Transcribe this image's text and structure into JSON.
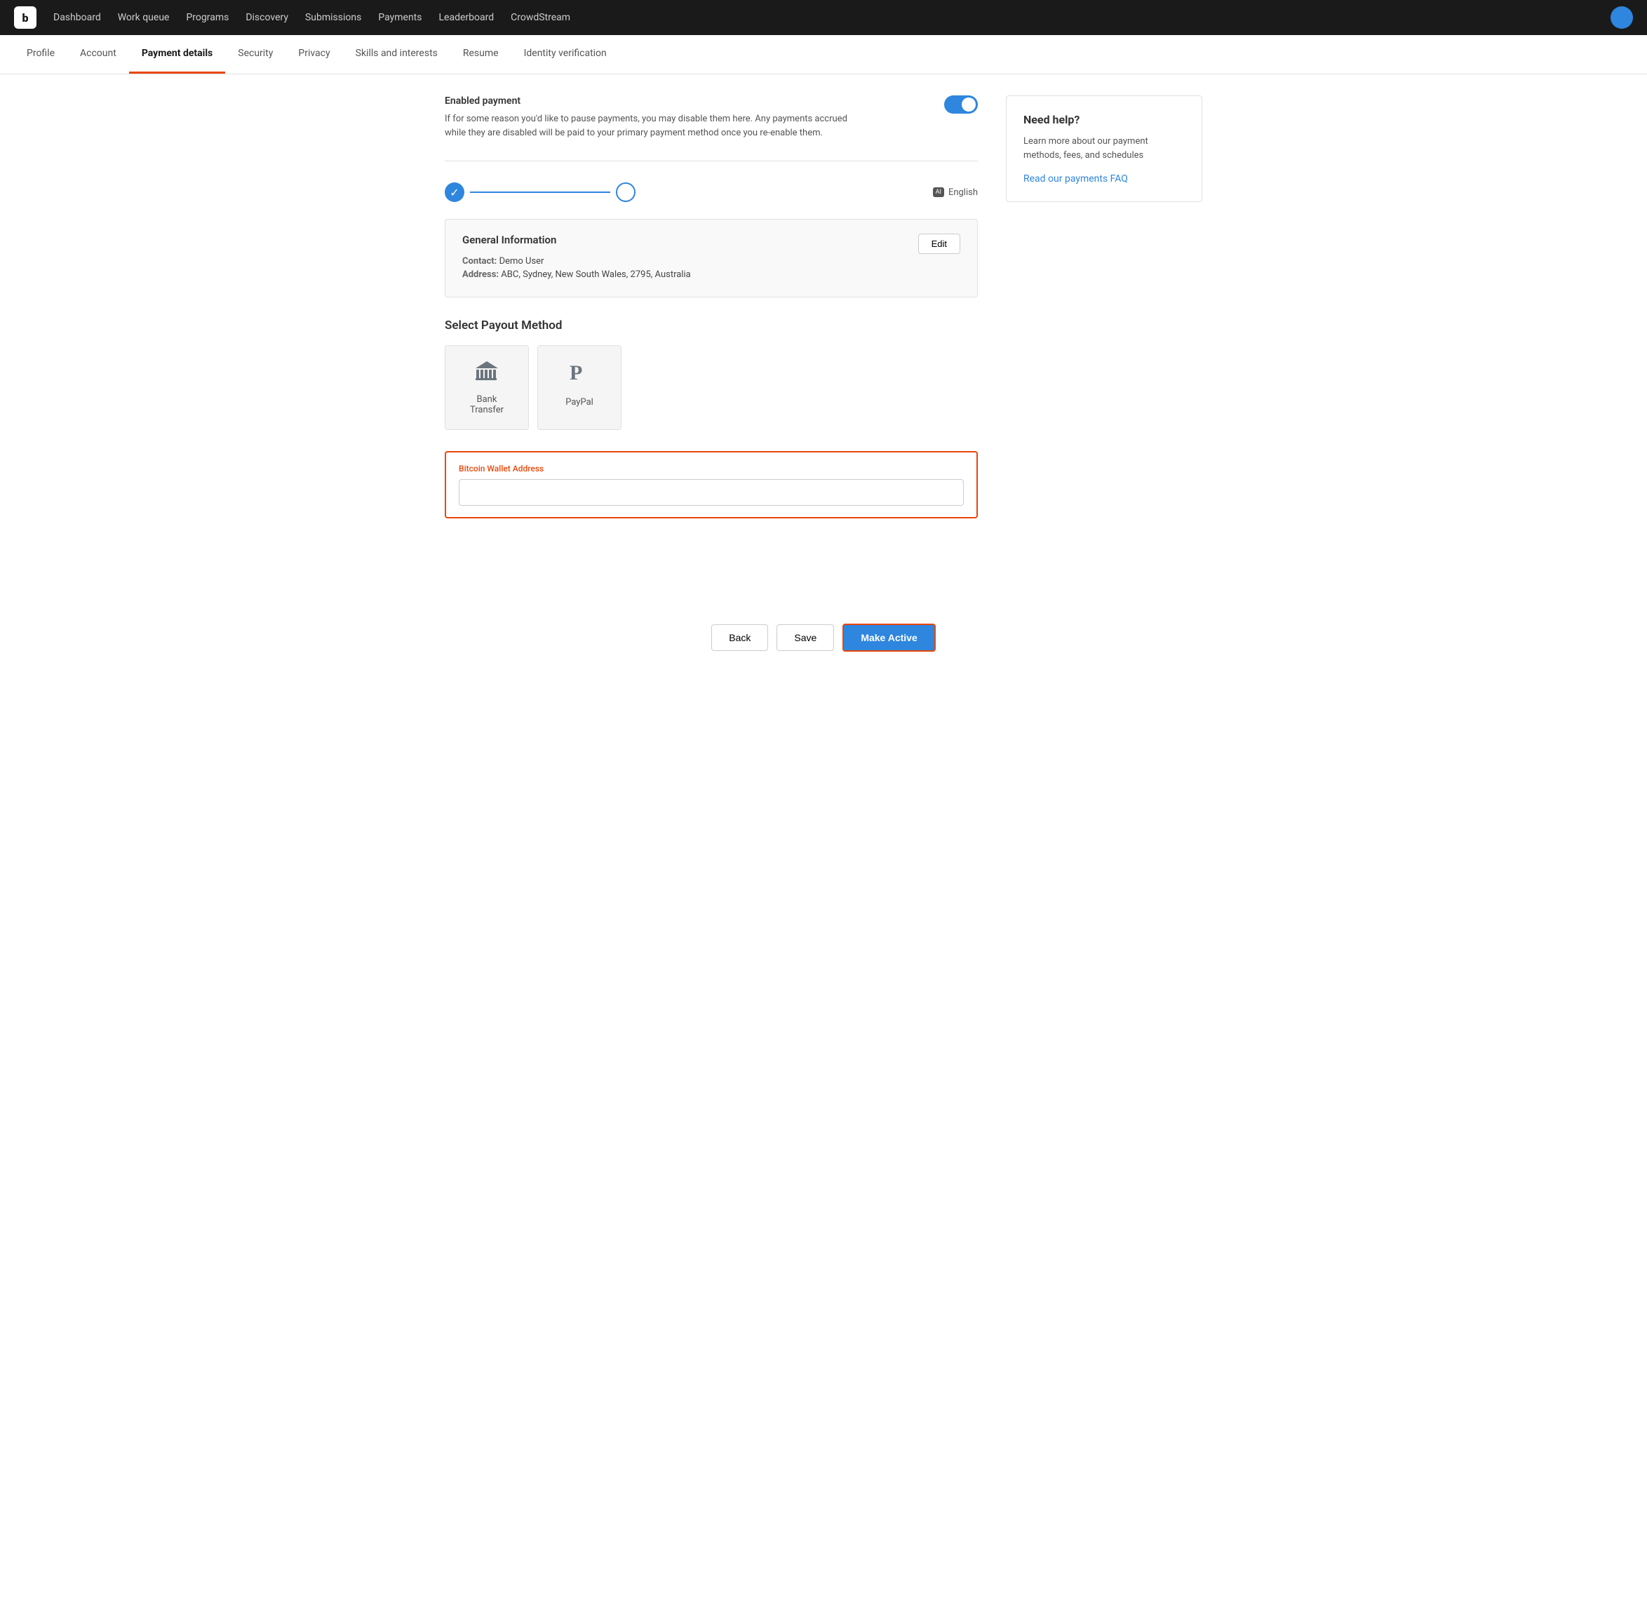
{
  "topnav": {
    "logo": "b",
    "items": [
      {
        "label": "Dashboard",
        "href": "#"
      },
      {
        "label": "Work queue",
        "href": "#"
      },
      {
        "label": "Programs",
        "href": "#"
      },
      {
        "label": "Discovery",
        "href": "#"
      },
      {
        "label": "Submissions",
        "href": "#"
      },
      {
        "label": "Payments",
        "href": "#"
      },
      {
        "label": "Leaderboard",
        "href": "#"
      },
      {
        "label": "CrowdStream",
        "href": "#"
      }
    ]
  },
  "subnav": {
    "items": [
      {
        "label": "Profile",
        "active": false
      },
      {
        "label": "Account",
        "active": false
      },
      {
        "label": "Payment details",
        "active": true
      },
      {
        "label": "Security",
        "active": false
      },
      {
        "label": "Privacy",
        "active": false
      },
      {
        "label": "Skills and interests",
        "active": false
      },
      {
        "label": "Resume",
        "active": false
      },
      {
        "label": "Identity verification",
        "active": false
      }
    ]
  },
  "enabled_payment": {
    "title": "Enabled payment",
    "description": "If for some reason you'd like to pause payments, you may disable them here. Any payments accrued while they are disabled will be paid to your primary payment method once you re-enable them."
  },
  "language": {
    "label": "English",
    "icon": "AI"
  },
  "general_info": {
    "title": "General Information",
    "edit_label": "Edit",
    "contact_label": "Contact:",
    "contact_value": "Demo User",
    "address_label": "Address:",
    "address_value": "ABC, Sydney, New South Wales, 2795, Australia"
  },
  "payout": {
    "section_title": "Select Payout Method",
    "methods": [
      {
        "id": "bank-transfer",
        "label": "Bank Transfer",
        "icon": "bank"
      },
      {
        "id": "paypal",
        "label": "PayPal",
        "icon": "paypal"
      }
    ]
  },
  "bitcoin": {
    "label": "Bitcoin Wallet Address",
    "placeholder": ""
  },
  "help": {
    "title": "Need help?",
    "description": "Learn more about our payment methods, fees, and schedules",
    "link_label": "Read our payments FAQ"
  },
  "footer": {
    "back_label": "Back",
    "save_label": "Save",
    "make_active_label": "Make Active"
  }
}
